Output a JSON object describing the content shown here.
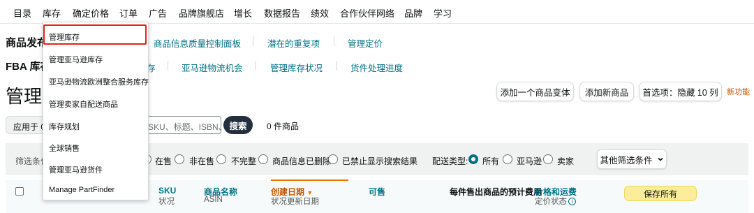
{
  "topnav": {
    "items": [
      "目录",
      "库存",
      "确定价格",
      "订单",
      "广告",
      "品牌旗舰店",
      "增长",
      "数据报告",
      "绩效",
      "合作伙伴网络",
      "品牌",
      "学习"
    ]
  },
  "listings_row": {
    "label": "商品发布",
    "links": [
      "商品信息质量控制面板",
      "潜在的重复项",
      "管理定价"
    ]
  },
  "fba_row": {
    "label": "FBA 库存",
    "links": [
      "存",
      "亚马逊物流机会",
      "管理库存状况",
      "货件处理进度"
    ]
  },
  "page": {
    "title": "管理库存",
    "actions": [
      "添加一个商品变体",
      "添加新商品",
      "首选项：隐藏 10 列"
    ],
    "new_feature": "新功能"
  },
  "search": {
    "apply_to": "应用于 0",
    "placeholder": "SKU、标题、ISBN、",
    "button": "搜索",
    "count": "0 件商品"
  },
  "filters": {
    "label": "筛选条件",
    "status_options": [
      "在售",
      "非在售",
      "不完整",
      "商品信息已删除",
      "已禁止显示搜索结果"
    ],
    "fulfillment_label": "配送类型:",
    "fulfillment_options": [
      "所有",
      "亚马逊",
      "卖家"
    ],
    "more": "其他筛选条件"
  },
  "table_header": {
    "sku": "SKU",
    "sku_sub": "状况",
    "name": "商品名称",
    "name_sub": "ASIN",
    "created": "创建日期",
    "created_sub": "状况更新日期",
    "available": "可售",
    "fee": "每件售出商品的预计费用",
    "price": "价格和运费",
    "price_sub": "定价状态",
    "save_all": "保存所有"
  },
  "dropdown": {
    "items": [
      "管理库存",
      "管理亚马逊库存",
      "亚马逊物流欧洲整合服务库存",
      "管理卖家自配送商品",
      "库存规划",
      "全球销售",
      "管理亚马逊货件",
      "Manage PartFinder"
    ]
  },
  "colors": {
    "link": "#007185",
    "highlight": "#e3241b",
    "save_button": "#fcec9c",
    "search_button": "#232f3e",
    "sort_accent": "#e77600"
  }
}
